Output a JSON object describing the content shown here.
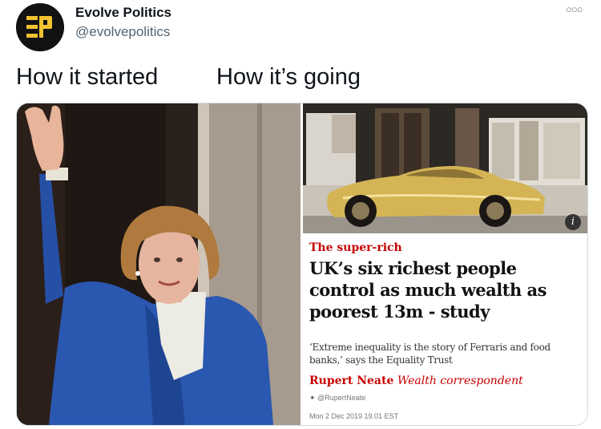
{
  "tweet": {
    "display_name": "Evolve Politics",
    "handle": "@evolvepolitics",
    "more_icon": "more-options-icon",
    "caption_left": "How it started",
    "caption_right": "How it’s going"
  },
  "article": {
    "kicker": "The super-rich",
    "headline": "UK’s six richest people control as much wealth as poorest 13m - study",
    "standfirst": "‘Extreme inequality is the story of Ferraris and food banks,’ says the Equality Trust",
    "author": "Rupert Neate",
    "author_role": "Wealth correspondent",
    "twitter_handle": "@RupertNeate",
    "date": "Mon 2 Dec 2019 19.01 EST",
    "info_badge": "i"
  },
  "colors": {
    "guardian_red": "#c70000",
    "handle_grey": "#536471"
  }
}
